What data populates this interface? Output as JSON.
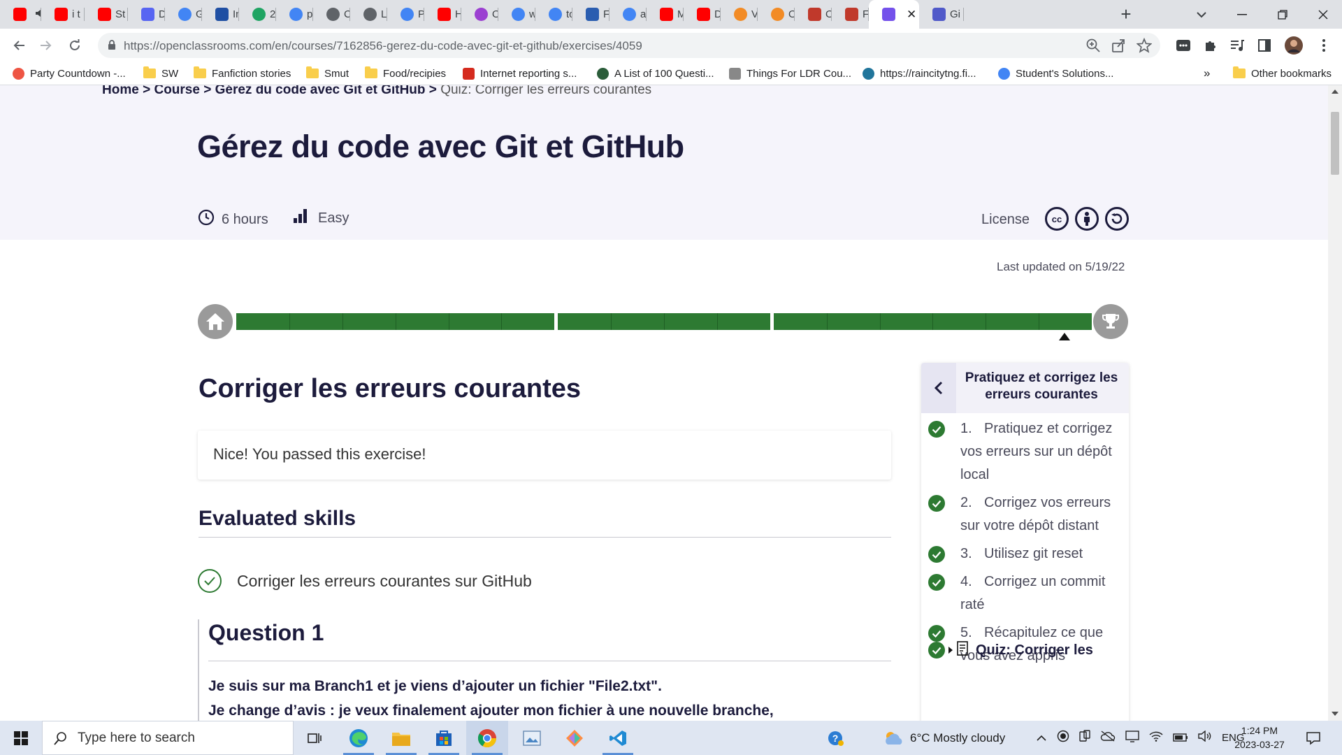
{
  "browser": {
    "tabs": [
      {
        "label": "",
        "icon": "youtube-icon",
        "color": "#ff0000"
      },
      {
        "label": "i t",
        "icon": "youtube-icon",
        "color": "#ff0000"
      },
      {
        "label": "St",
        "icon": "youtube-icon",
        "color": "#ff0000"
      },
      {
        "label": "Di",
        "icon": "discord-icon",
        "color": "#5865f2"
      },
      {
        "label": "Gc",
        "icon": "google-translate-icon",
        "color": "#4285f4"
      },
      {
        "label": "In",
        "icon": "fleur-de-lis-icon",
        "color": "#1f4fa3"
      },
      {
        "label": "2",
        "icon": "google-drive-icon",
        "color": "#1fa463"
      },
      {
        "label": "pc",
        "icon": "google-icon",
        "color": "#4285f4"
      },
      {
        "label": "Cl",
        "icon": "globe-icon",
        "color": "#5f6368"
      },
      {
        "label": "Li",
        "icon": "globe-icon",
        "color": "#5f6368"
      },
      {
        "label": "Pi",
        "icon": "google-docs-icon",
        "color": "#4285f4"
      },
      {
        "label": "H",
        "icon": "youtube-icon",
        "color": "#ff0000"
      },
      {
        "label": "O",
        "icon": "podcast-icon",
        "color": "#9b3fd1"
      },
      {
        "label": "wi",
        "icon": "google-icon",
        "color": "#4285f4"
      },
      {
        "label": "to",
        "icon": "google-icon",
        "color": "#4285f4"
      },
      {
        "label": "Fc",
        "icon": "flag-icon",
        "color": "#2a5db0"
      },
      {
        "label": "as",
        "icon": "google-icon",
        "color": "#4285f4"
      },
      {
        "label": "M",
        "icon": "youtube-icon",
        "color": "#ff0000"
      },
      {
        "label": "Di",
        "icon": "youtube-icon",
        "color": "#ff0000"
      },
      {
        "label": "Vi",
        "icon": "flower-icon",
        "color": "#f28b25"
      },
      {
        "label": "O",
        "icon": "flower-icon",
        "color": "#f28b25"
      },
      {
        "label": "O",
        "icon": "figure-icon",
        "color": "#c0392b"
      },
      {
        "label": "Fu",
        "icon": "figure-icon",
        "color": "#c0392b"
      },
      {
        "label": "",
        "icon": "openclassrooms-icon",
        "color": "#7451eb"
      },
      {
        "label": "Gi",
        "icon": "teams-icon",
        "color": "#5059c9"
      }
    ],
    "url_host": "https://openclassrooms.com",
    "url_path": "/en/courses/7162856-gerez-du-code-avec-git-et-github/exercises/4059",
    "bookmarks": [
      {
        "label": "Party Countdown -...",
        "icon": "party-icon"
      },
      {
        "label": "SW",
        "icon": "folder-icon"
      },
      {
        "label": "Fanfiction stories",
        "icon": "folder-icon"
      },
      {
        "label": "Smut",
        "icon": "folder-icon"
      },
      {
        "label": "Food/recipies",
        "icon": "folder-icon"
      },
      {
        "label": "Internet reporting s...",
        "icon": "maple-leaf-icon"
      },
      {
        "label": "A List of 100 Questi...",
        "icon": "site-icon"
      },
      {
        "label": "Things For LDR Cou...",
        "icon": "document-icon"
      },
      {
        "label": "https://raincitytng.fi...",
        "icon": "wordpress-icon"
      },
      {
        "label": "Student's Solutions...",
        "icon": "google-icon"
      }
    ],
    "more_bookmarks": "»",
    "other_bookmarks": "Other bookmarks"
  },
  "page": {
    "breadcrumb": {
      "home": "Home",
      "sep": ">",
      "course": "Course",
      "title": "Gérez du code avec Git et GitHub",
      "current": "Quiz: Corriger les erreurs courantes"
    },
    "course_title": "Gérez du code avec Git et GitHub",
    "duration": "6 hours",
    "difficulty": "Easy",
    "license_label": "License",
    "license_badges": [
      "cc",
      "by",
      "sa"
    ],
    "last_updated": "Last updated on 5/19/22",
    "progress": {
      "completed_fraction": 1.0,
      "parts": [
        6,
        4,
        6
      ],
      "current_step": 16
    },
    "exercise_title": "Corriger les erreurs courantes",
    "passed_message": "Nice! You passed this exercise!",
    "skills_heading": "Evaluated skills",
    "skills": [
      "Corriger les erreurs courantes sur GitHub"
    ],
    "question_heading": "Question 1",
    "question_lines": [
      "Je suis sur ma Branch1 et je viens d’ajouter un fichier \"File2.txt\".",
      "Je change d’avis : je veux finalement ajouter mon fichier à une nouvelle branche,"
    ],
    "colors": {
      "success": "#2d7a32",
      "ink": "#1c1b3c",
      "hero_bg": "#f5f4fb"
    }
  },
  "panel": {
    "title": "Pratiquez et corrigez les erreurs courantes",
    "items": [
      {
        "num": "1.",
        "text": "Pratiquez et corrigez vos erreurs sur un dépôt local",
        "done": true
      },
      {
        "num": "2.",
        "text": "Corrigez vos erreurs sur votre dépôt distant",
        "done": true
      },
      {
        "num": "3.",
        "text": "Utilisez git reset",
        "done": true
      },
      {
        "num": "4.",
        "text": "Corrigez un commit raté",
        "done": true
      },
      {
        "num": "5.",
        "text": "Récapitulez ce que vous avez appris",
        "done": true
      }
    ],
    "quiz_label": "Quiz: Corriger les"
  },
  "taskbar": {
    "search_placeholder": "Type here to search",
    "weather": "6°C  Mostly cloudy",
    "language": "ENG",
    "time": "1:24 PM",
    "date": "2023-03-27"
  }
}
